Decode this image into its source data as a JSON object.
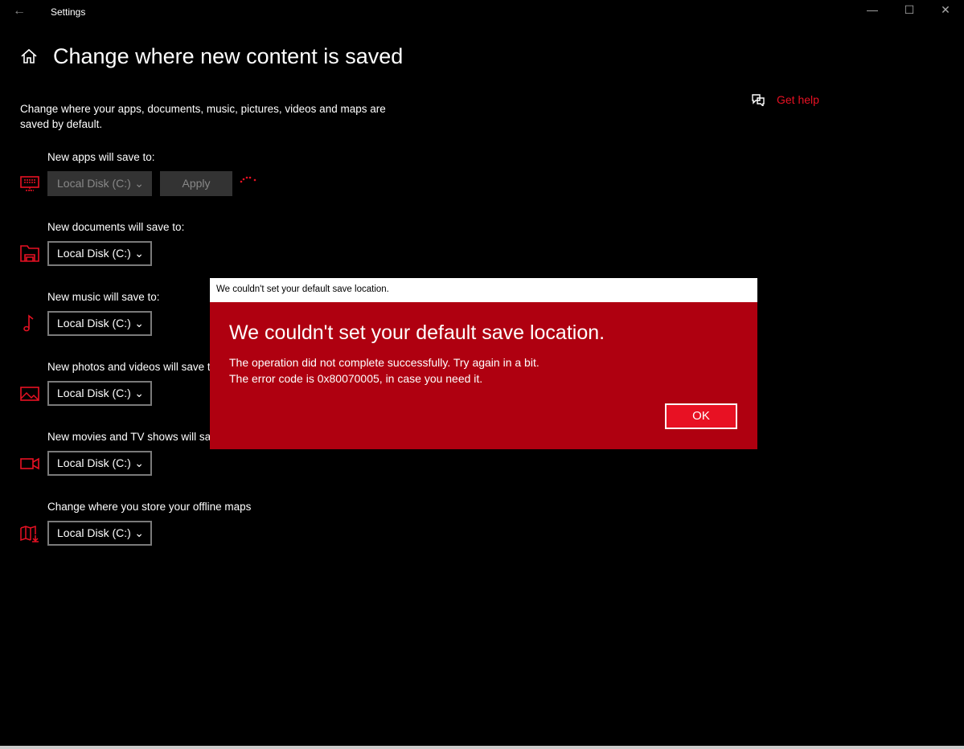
{
  "window": {
    "title": "Settings",
    "back": "←",
    "minimize": "—",
    "maximize": "☐",
    "close": "✕"
  },
  "page": {
    "title": "Change where new content is saved",
    "description": "Change where your apps, documents, music, pictures, videos and maps are saved by default.",
    "help": "Get help"
  },
  "rows": [
    {
      "label": "New apps will save to:",
      "value": "Local Disk (C:)",
      "icon": "monitor-icon",
      "disabled": true
    },
    {
      "label": "New documents will save to:",
      "value": "Local Disk (C:)",
      "icon": "folder-icon"
    },
    {
      "label": "New music will save to:",
      "value": "Local Disk (C:)",
      "icon": "music-note-icon"
    },
    {
      "label": "New photos and videos will save to:",
      "value": "Local Disk (C:)",
      "icon": "photo-icon"
    },
    {
      "label": "New movies and TV shows will save to:",
      "value": "Local Disk (C:)",
      "icon": "video-camera-icon"
    },
    {
      "label": "Change where you store your offline maps",
      "value": "Local Disk (C:)",
      "icon": "map-download-icon"
    }
  ],
  "apply": "Apply",
  "dialog": {
    "window_title": "We couldn't set your default save location.",
    "heading": "We couldn't set your default save location.",
    "line1": "The operation did not complete successfully. Try again in a bit.",
    "line2": "The error code is 0x80070005, in case you need it.",
    "ok": "OK"
  },
  "colors": {
    "accent": "#e81123",
    "dialog": "#af0010"
  }
}
